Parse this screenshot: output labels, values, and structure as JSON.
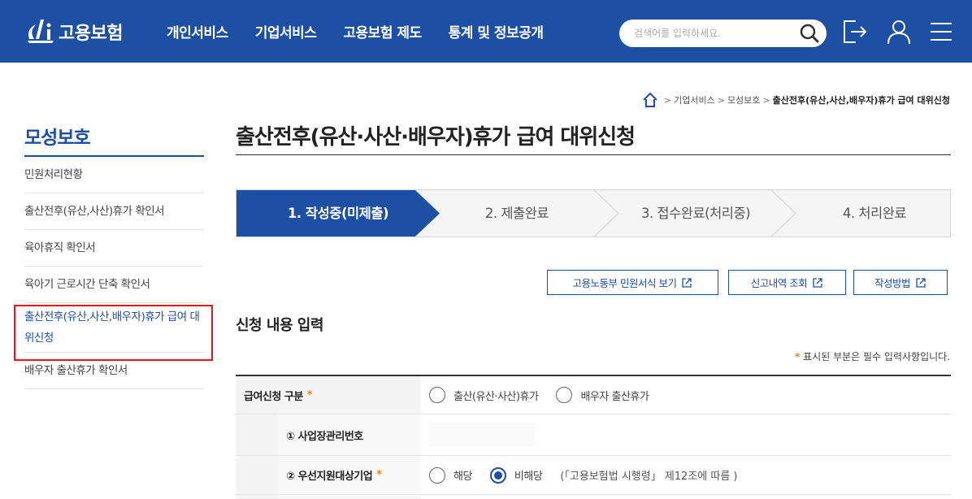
{
  "header": {
    "logo_text": "고용보험",
    "nav": [
      "개인서비스",
      "기업서비스",
      "고용보험 제도",
      "통계 및 정보공개"
    ],
    "search_placeholder": "검색어를 입력하세요."
  },
  "breadcrumb": {
    "items": [
      "기업서비스",
      "모성보호"
    ],
    "current": "출산전후(유산,사산,배우자)휴가 급여 대위신청"
  },
  "sidebar": {
    "title": "모성보호",
    "items": [
      "민원처리현황",
      "출산전후(유산,사산)휴가 확인서",
      "육아휴직 확인서",
      "육아기 근로시간 단축 확인서",
      "출산전후(유산,사산,배우자)휴가 급여 대위신청",
      "배우자 출산휴가 확인서"
    ],
    "active_index": 4
  },
  "main": {
    "title": "출산전후(유산·사산·배우자)휴가 급여 대위신청",
    "steps": [
      "1. 작성중(미제출)",
      "2. 제출완료",
      "3. 접수완료(처리중)",
      "4. 처리완료"
    ],
    "active_step": 0,
    "buttons": [
      "고용노동부 민원서식 보기",
      "신고내역 조회",
      "작성방법"
    ],
    "section_title": "신청 내용 입력",
    "required_note_star": "*",
    "required_note": "표시된 부분은 필수 입력사항입니다."
  },
  "form": {
    "row1": {
      "label": "급여신청 구분",
      "star": "*",
      "options": [
        "출산(유산·사산)휴가",
        "배우자 출산휴가"
      ]
    },
    "row2": {
      "label": "① 사업장관리번호"
    },
    "row3": {
      "label": "② 우선지원대상기업",
      "star": "*",
      "options": [
        "해당",
        "비해당"
      ],
      "selected": 1,
      "note": "(「고용보험법 시행령」 제12조에 따름 )"
    }
  },
  "colors": {
    "brand": "#1d4fa3",
    "accent_star": "#f08223",
    "highlight": "#e5131d"
  }
}
